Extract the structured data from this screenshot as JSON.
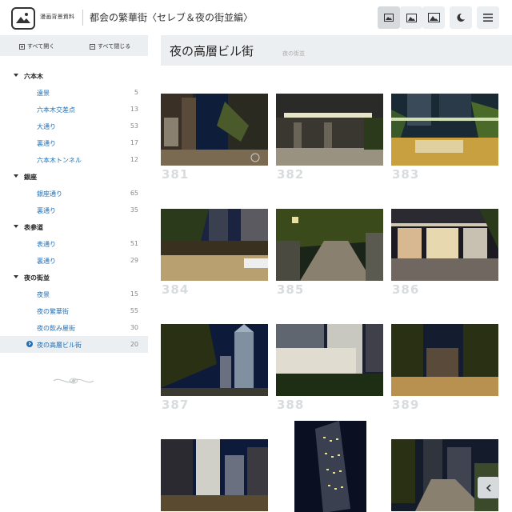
{
  "header": {
    "site_name": "漫画背景資料",
    "title": "都会の繁華街〈セレブ＆夜の街並編〉",
    "buttons": [
      {
        "name": "view-small",
        "icon": "image-icon"
      },
      {
        "name": "view-medium",
        "icon": "image-icon"
      },
      {
        "name": "view-large",
        "icon": "image-icon"
      },
      {
        "name": "dark-mode",
        "icon": "moon-icon"
      },
      {
        "name": "menu",
        "icon": "hamburger-icon"
      }
    ]
  },
  "sidebar": {
    "open_all": "すべて開く",
    "close_all": "すべて閉じる",
    "groups": [
      {
        "label": "六本木",
        "items": [
          {
            "label": "遠景",
            "count": "5"
          },
          {
            "label": "六本木交差点",
            "count": "13"
          },
          {
            "label": "大通り",
            "count": "53"
          },
          {
            "label": "裏通り",
            "count": "17"
          },
          {
            "label": "六本木トンネル",
            "count": "12"
          }
        ]
      },
      {
        "label": "銀座",
        "items": [
          {
            "label": "銀座通り",
            "count": "65"
          },
          {
            "label": "裏通り",
            "count": "35"
          }
        ]
      },
      {
        "label": "表参道",
        "items": [
          {
            "label": "表通り",
            "count": "51"
          },
          {
            "label": "裏通り",
            "count": "29"
          }
        ]
      },
      {
        "label": "夜の街並",
        "items": [
          {
            "label": "夜景",
            "count": "15"
          },
          {
            "label": "夜の繁華街",
            "count": "55"
          },
          {
            "label": "夜の飲み屋街",
            "count": "30"
          },
          {
            "label": "夜の高層ビル街",
            "count": "20",
            "active": true
          }
        ]
      }
    ]
  },
  "main": {
    "title": "夜の高層ビル街",
    "subtitle": "夜の街並",
    "thumbnails": [
      {
        "number": "381"
      },
      {
        "number": "382"
      },
      {
        "number": "383"
      },
      {
        "number": "384"
      },
      {
        "number": "385"
      },
      {
        "number": "386"
      },
      {
        "number": "387"
      },
      {
        "number": "388"
      },
      {
        "number": "389"
      },
      {
        "number": ""
      },
      {
        "number": ""
      },
      {
        "number": ""
      }
    ]
  },
  "colors": {
    "accent": "#1e6fb8",
    "panel": "#eceff1",
    "number": "#d8dcde"
  }
}
